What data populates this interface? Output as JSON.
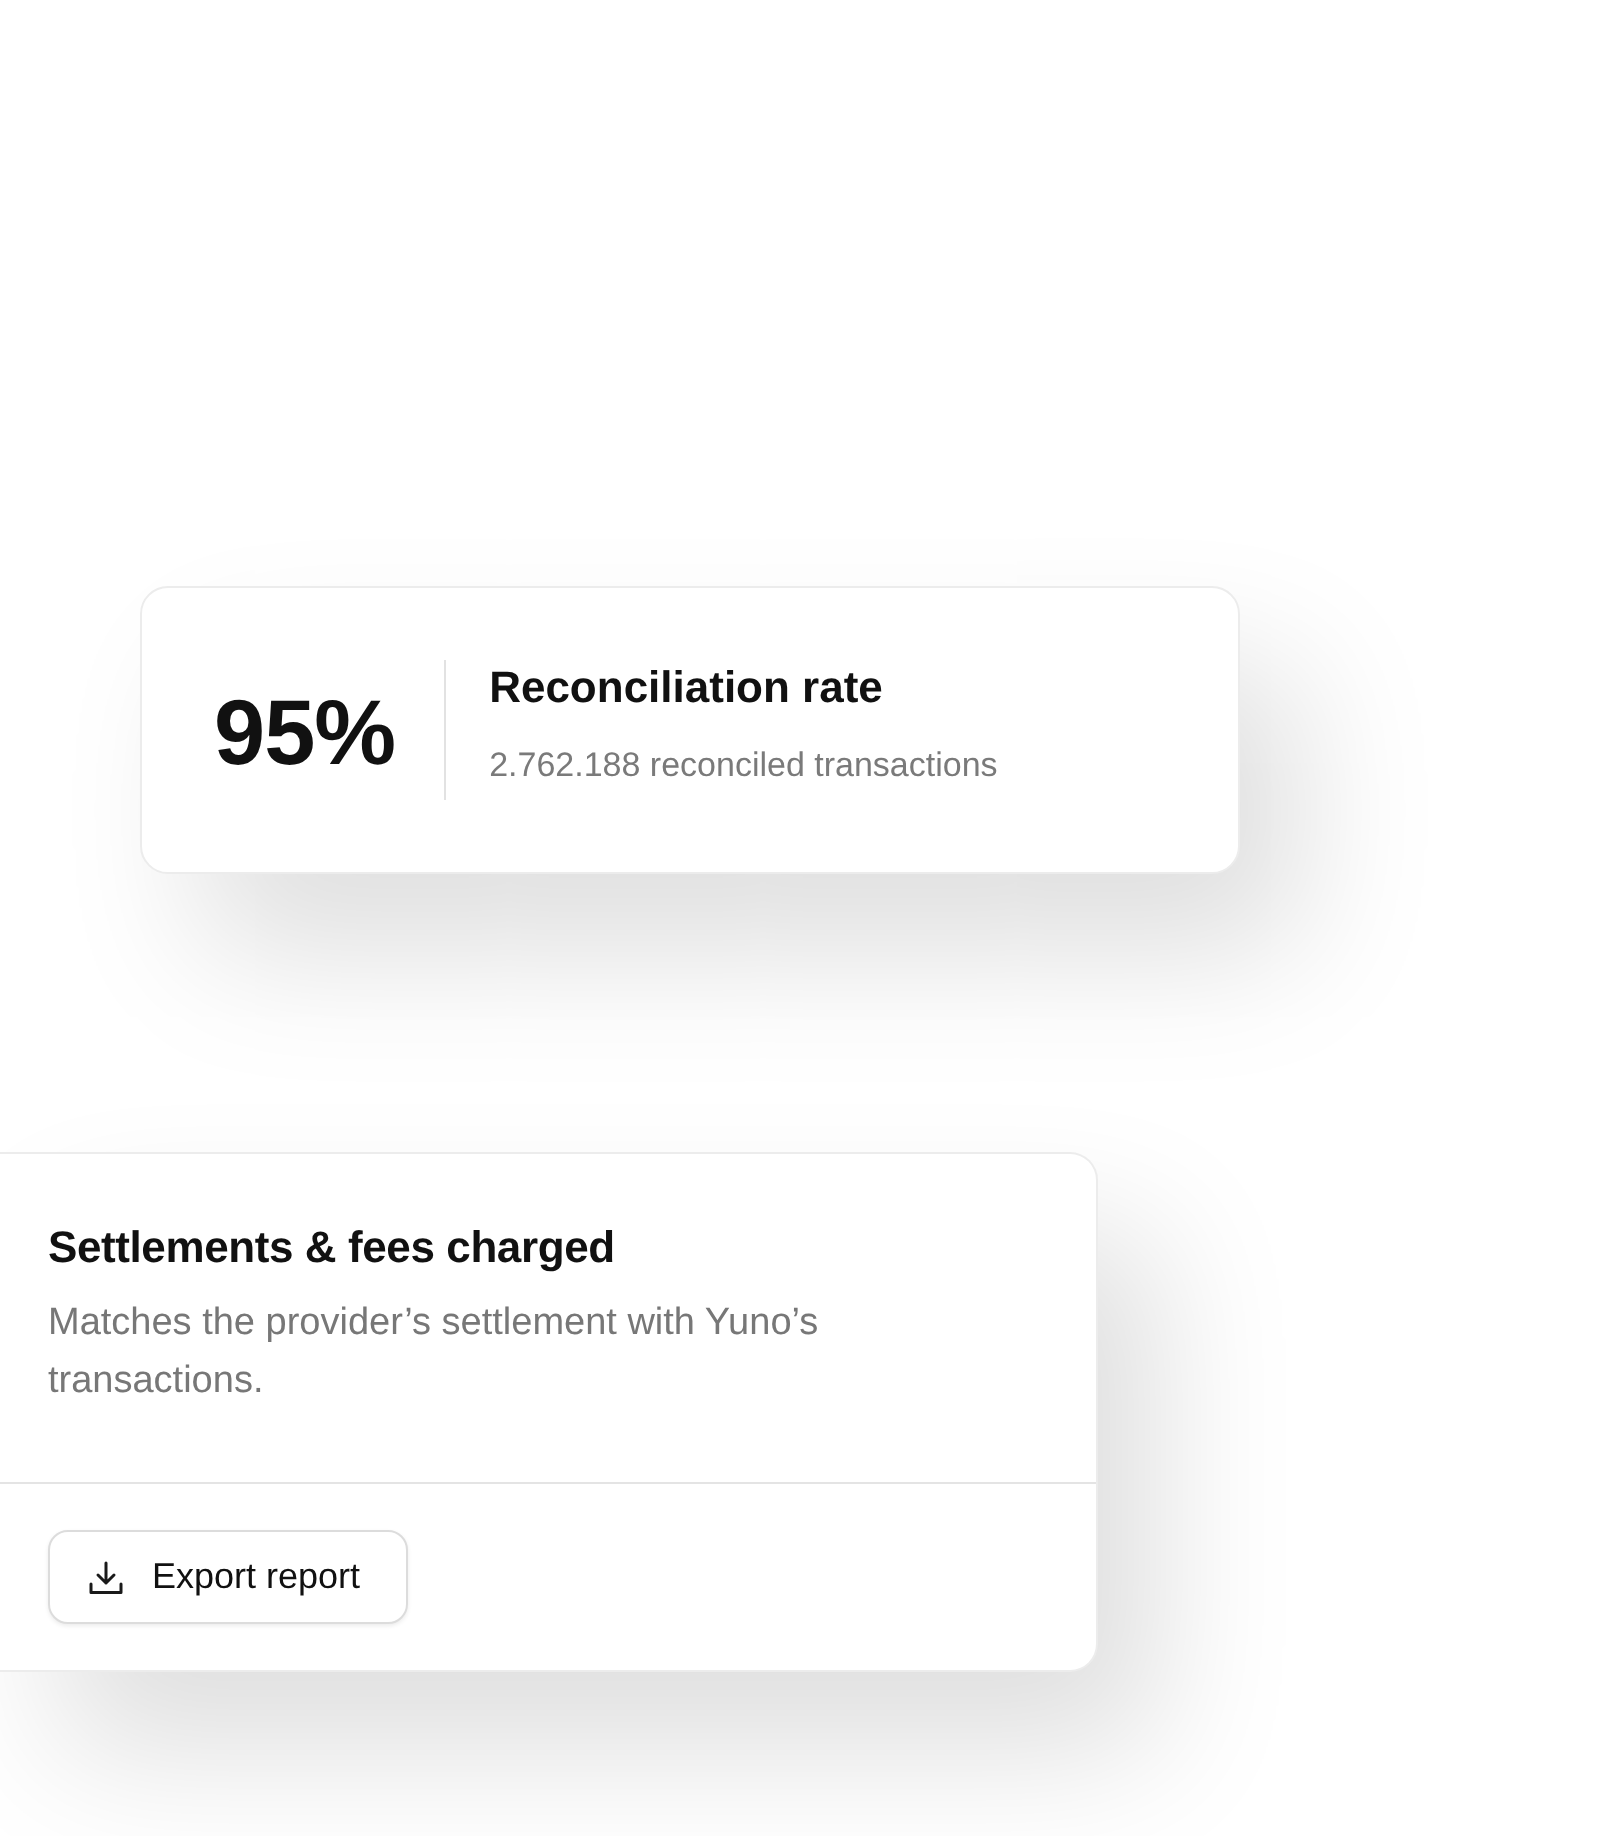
{
  "metric_card": {
    "value": "95%",
    "title": "Reconciliation rate",
    "subtitle": "2.762.188 reconciled transactions"
  },
  "report_card": {
    "title": "Settlements & fees charged",
    "description": "Matches the provider’s settlement with Yuno’s transactions.",
    "button": {
      "label": "Export report"
    }
  }
}
